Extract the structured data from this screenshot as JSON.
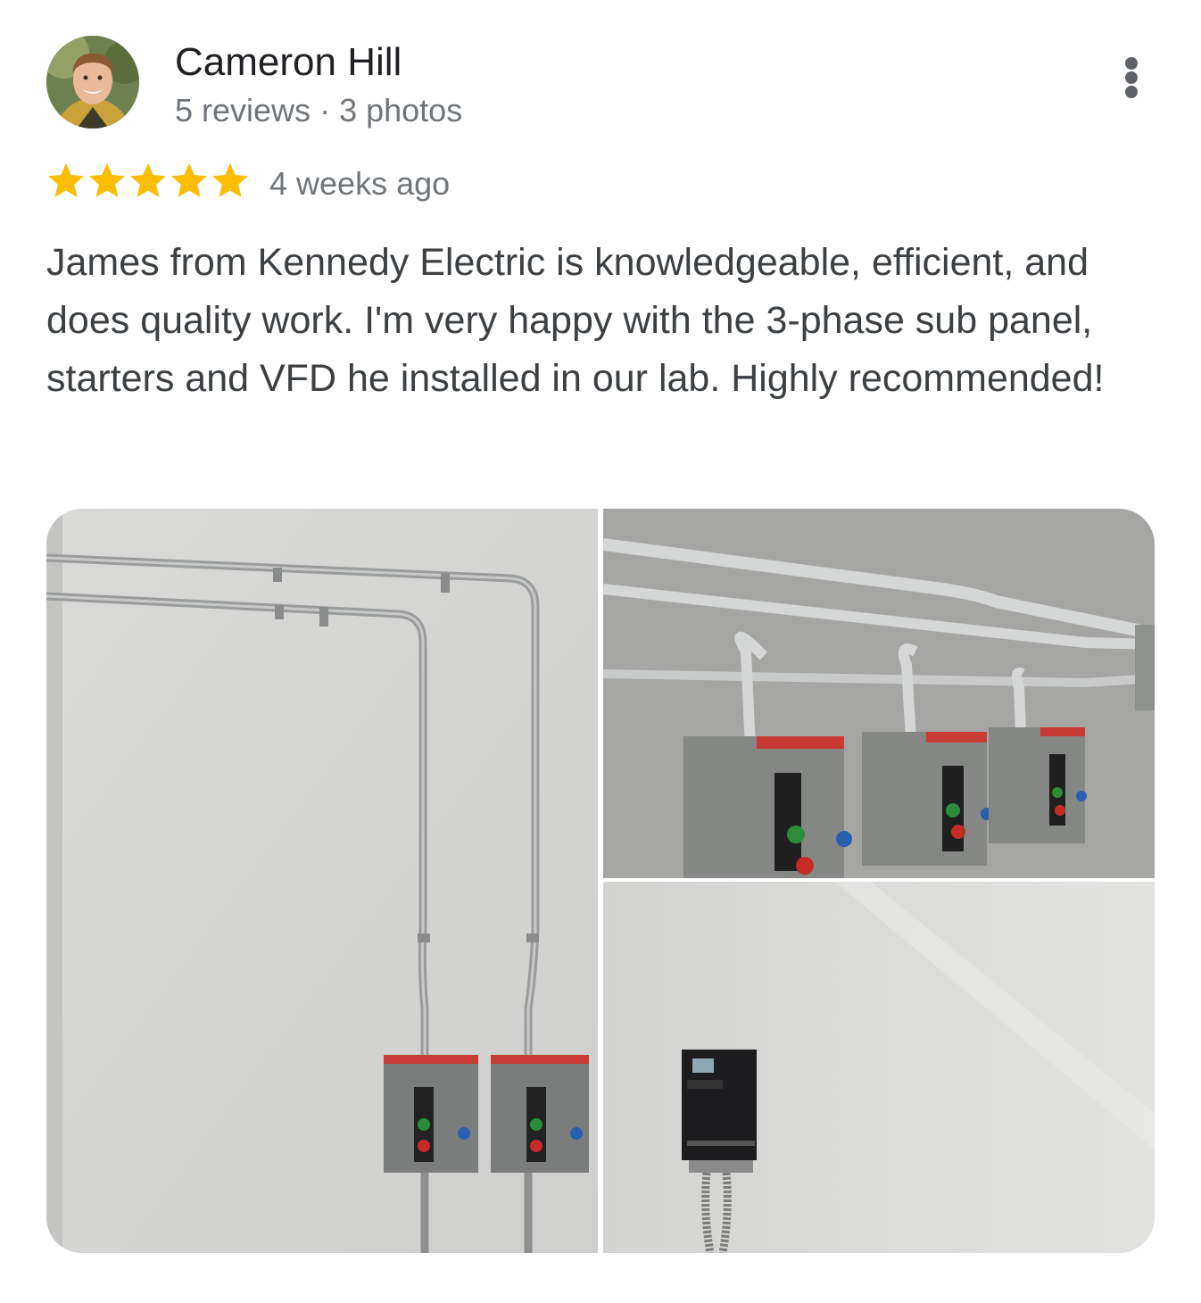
{
  "review": {
    "author": {
      "name": "Cameron Hill",
      "reviews": "5 reviews",
      "separator": "·",
      "photos": "3 photos"
    },
    "rating": 5,
    "rating_max": 5,
    "star_color": "#fbbc04",
    "posted": "4 weeks ago",
    "text": "James from Kennedy Electric is knowledgeable, efficient, and does quality work. I'm very happy with the 3-phase sub panel, starters and VFD he installed in our lab. Highly recommended!",
    "more_icon": "more-vert-icon"
  },
  "photos": {
    "count": 3
  }
}
